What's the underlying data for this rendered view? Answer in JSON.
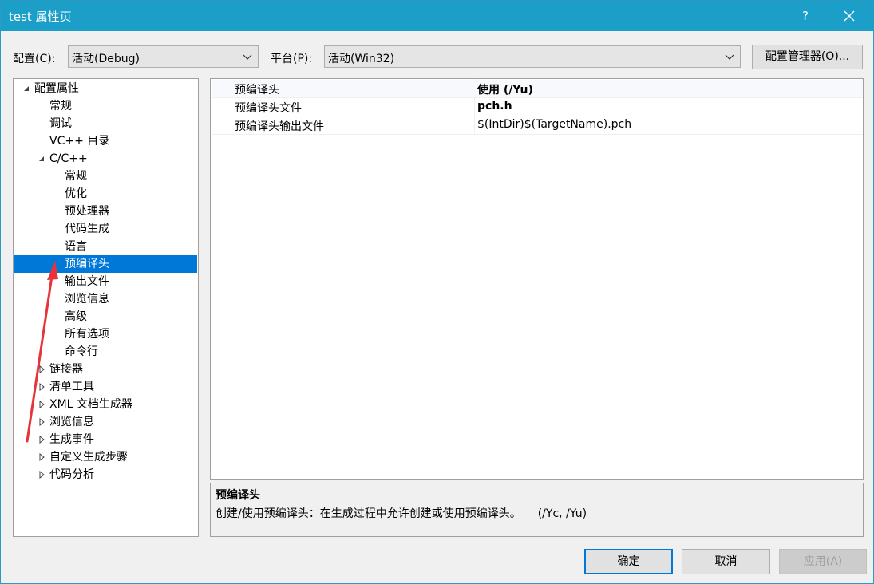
{
  "window": {
    "title": "test 属性页",
    "help": "?",
    "close_icon": "close-icon"
  },
  "config": {
    "label": "配置(C):",
    "value": "活动(Debug)"
  },
  "platform": {
    "label": "平台(P):",
    "value": "活动(Win32)"
  },
  "config_manager_label": "配置管理器(O)...",
  "tree": {
    "items": [
      {
        "label": "配置属性",
        "expander": "expanded"
      },
      {
        "label": "常规"
      },
      {
        "label": "调试"
      },
      {
        "label": "VC++ 目录"
      },
      {
        "label": "C/C++",
        "expander": "expanded"
      },
      {
        "label": "常规"
      },
      {
        "label": "优化"
      },
      {
        "label": "预处理器"
      },
      {
        "label": "代码生成"
      },
      {
        "label": "语言"
      },
      {
        "label": "预编译头",
        "selected": true
      },
      {
        "label": "输出文件"
      },
      {
        "label": "浏览信息"
      },
      {
        "label": "高级"
      },
      {
        "label": "所有选项"
      },
      {
        "label": "命令行"
      },
      {
        "label": "链接器",
        "expander": "collapsed"
      },
      {
        "label": "清单工具",
        "expander": "collapsed"
      },
      {
        "label": "XML 文档生成器",
        "expander": "collapsed"
      },
      {
        "label": "浏览信息",
        "expander": "collapsed"
      },
      {
        "label": "生成事件",
        "expander": "collapsed"
      },
      {
        "label": "自定义生成步骤",
        "expander": "collapsed"
      },
      {
        "label": "代码分析",
        "expander": "collapsed"
      }
    ]
  },
  "grid": {
    "rows": [
      {
        "name": "预编译头",
        "value": "使用 (/Yu)",
        "bold": true
      },
      {
        "name": "预编译头文件",
        "value": "pch.h",
        "bold": true
      },
      {
        "name": "预编译头输出文件",
        "value": "$(IntDir)$(TargetName).pch",
        "bold": false
      }
    ]
  },
  "description": {
    "title": "预编译头",
    "text": "创建/使用预编译头：在生成过程中允许创建或使用预编译头。　　(/Yc, /Yu)"
  },
  "buttons": {
    "ok": "确定",
    "cancel": "取消",
    "apply": "应用(A)"
  },
  "colors": {
    "titlebar": "#1b9fc9",
    "selection": "#0078d7",
    "annotation_arrow": "#e8333a"
  }
}
